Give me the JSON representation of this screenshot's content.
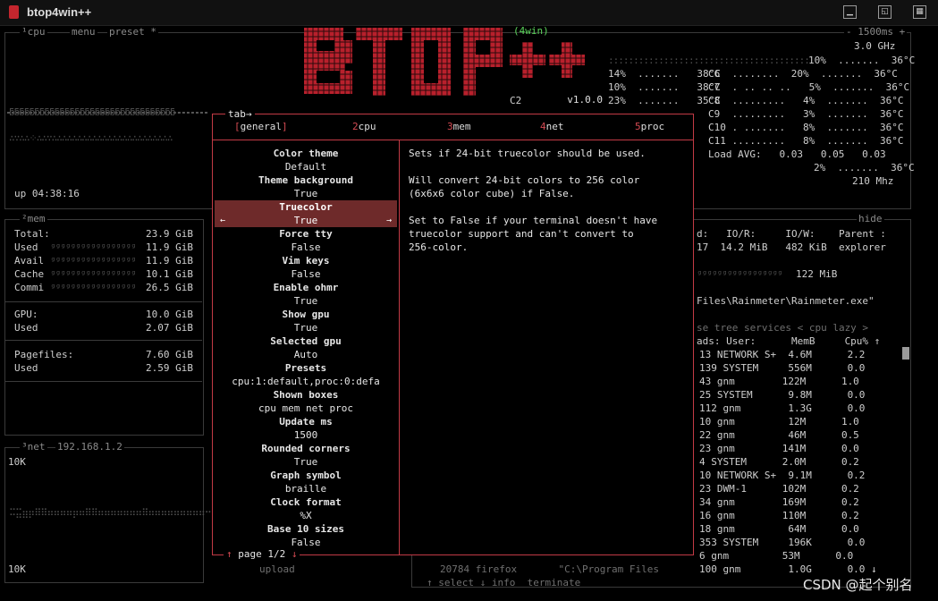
{
  "window": {
    "title": "btop4win++"
  },
  "logo": {
    "text": "BTOP++",
    "badge": "(4win)",
    "version": "v1.0.0"
  },
  "cpu_box": {
    "label": "¹cpu",
    "menu": "menu",
    "preset": "preset *",
    "refresh": "- 1500ms +",
    "freq": "3.0 GHz",
    "uptime": "up 04:38:16",
    "cores_left": [
      "14%  .......   38°C",
      "10%  .......   38°C",
      "23%  .......   35°C"
    ],
    "c2": "C2",
    "cores_right": [
      "10%  .......  36°C",
      "C6  ........  20%  .......  36°C",
      "C7  . .. .. ..   5%  .......  36°C",
      "C8  .........   4%  .......  36°C",
      "C9  .........   3%  .......  36°C",
      "C10 . .......   8%  .......  36°C",
      "C11 .........   8%  .......  36°C",
      "Load AVG:   0.03   0.05   0.03",
      "2%  .......  36°C",
      "210 Mhz"
    ]
  },
  "mem_box": {
    "label": "²mem",
    "rows": [
      {
        "k": "Total:",
        "v": "23.9 GiB"
      },
      {
        "k": "Used",
        "v": "11.9 GiB"
      },
      {
        "k": "Avail",
        "v": "11.9 GiB"
      },
      {
        "k": "Cache",
        "v": "10.1 GiB"
      },
      {
        "k": "Commi",
        "v": "26.5 GiB"
      }
    ],
    "gpu": {
      "k": "GPU:",
      "v": "10.0 GiB",
      "k2": "Used",
      "v2": "2.07 GiB"
    },
    "page": {
      "k": "Pagefiles:",
      "v": "7.60 GiB",
      "k2": "Used",
      "v2": "2.59 GiB"
    }
  },
  "net_box": {
    "label": "³net",
    "ip": "192.168.1.2",
    "top": "10K",
    "bottom": "10K",
    "upload": "upload"
  },
  "proc_box": {
    "hide": "hide",
    "io_header": "d:   IO/R:     IO/W:    Parent :",
    "io_values": "17  14.2 MiB   482 KiB  explorer",
    "mem_line": "122 MiB",
    "path": "Files\\Rainmeter\\Rainmeter.exe\"",
    "controls": "se tree services < cpu lazy >",
    "header": "ads: User:      MemB     Cpu% ↑",
    "rows": [
      "13 NETWORK S+  4.6M      2.2",
      "139 SYSTEM     556M      0.0",
      "43 gnm        122M      1.0",
      "25 SYSTEM      9.8M      0.0",
      "112 gnm        1.3G      0.0",
      "10 gnm         12M      1.0",
      "22 gnm         46M      0.5",
      "23 gnm        141M      0.0",
      "4 SYSTEM      2.0M      0.2",
      "10 NETWORK S+  9.1M      0.2",
      "23 DWM-1      102M      0.2",
      "34 gnm        169M      0.2",
      "16 gnm        110M      0.2",
      "18 gnm         64M      0.0",
      "353 SYSTEM     196K      0.0",
      "6 gnm         53M      0.0",
      "100 gnm        1.0G      0.0 ↓"
    ],
    "bottom_proc": "20784 firefox       \"C:\\Program Files",
    "footer": "↑ select ↓ info  terminate"
  },
  "options": {
    "tab_label": "tab→",
    "tabs": [
      {
        "num": "1",
        "label": "general",
        "active": true
      },
      {
        "num": "2",
        "label": "cpu"
      },
      {
        "num": "3",
        "label": "mem"
      },
      {
        "num": "4",
        "label": "net"
      },
      {
        "num": "5",
        "label": "proc"
      }
    ],
    "items": [
      {
        "name": "Color theme",
        "value": "Default"
      },
      {
        "name": "Theme background",
        "value": "True"
      },
      {
        "name": "Truecolor",
        "value": "True"
      },
      {
        "name": "Force tty",
        "value": "False"
      },
      {
        "name": "Vim keys",
        "value": "False"
      },
      {
        "name": "Enable ohmr",
        "value": "True"
      },
      {
        "name": "Show gpu",
        "value": "True"
      },
      {
        "name": "Selected gpu",
        "value": "Auto"
      },
      {
        "name": "Presets",
        "value": "cpu:1:default,proc:0:defa"
      },
      {
        "name": "Shown boxes",
        "value": "cpu mem net proc"
      },
      {
        "name": "Update ms",
        "value": "1500"
      },
      {
        "name": "Rounded corners",
        "value": "True"
      },
      {
        "name": "Graph symbol",
        "value": "braille"
      },
      {
        "name": "Clock format",
        "value": "%X"
      },
      {
        "name": "Base 10 sizes",
        "value": "False"
      }
    ],
    "description": [
      "Sets if 24-bit truecolor should be used.",
      "",
      "Will convert 24-bit colors to 256 color",
      "(6x6x6 color cube) if False.",
      "",
      "Set to False if your terminal doesn't have",
      "truecolor support and can't convert to",
      "256-color."
    ],
    "page": "page 1/2",
    "up_arrow": "↑",
    "down_arrow": "↓",
    "left_arrow": "←",
    "right_arrow": "→"
  },
  "watermark": "CSDN @起个别名",
  "colors": {
    "accent": "#c23a45",
    "selected": "#6e2a2a",
    "logo": "#b8202c"
  }
}
